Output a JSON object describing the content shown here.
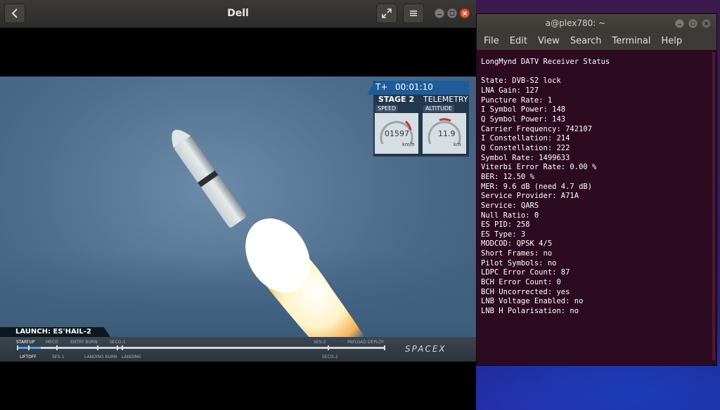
{
  "player": {
    "title": "Dell",
    "video": {
      "clock_prefix": "T+",
      "clock": "00:01:10",
      "stage": "STAGE 2",
      "telemetry": "TELEMETRY",
      "speed_label": "SPEED",
      "speed_value": "01597",
      "speed_unit": "km/h",
      "altitude_label": "ALTITUDE",
      "altitude_value": "11.9",
      "altitude_unit": "km",
      "launch_label": "LAUNCH: ES'HAIL-2",
      "timeline_top": [
        "STARTUP",
        "MECO",
        "ENTRY BURN",
        "SECO-1",
        "SES-2",
        "PAYLOAD DEPLOY"
      ],
      "timeline_bottom": [
        "LIFTOFF",
        "SES-1",
        "LANDING BURN",
        "LANDING",
        "SECO-2"
      ],
      "logo": "SPACEX"
    }
  },
  "terminal": {
    "title": "a@plex780: ~",
    "menu": [
      "File",
      "Edit",
      "View",
      "Search",
      "Terminal",
      "Help"
    ],
    "heading": "LongMynd DATV Receiver Status",
    "lines": [
      "State: DVB-S2 lock",
      "LNA Gain: 127",
      "Puncture Rate: 1",
      "I Symbol Power: 148",
      "Q Symbol Power: 143",
      "Carrier Frequency: 742107",
      "I Constellation: 214",
      "Q Constellation: 222",
      "Symbol Rate: 1499633",
      "Viterbi Error Rate: 0.00 %",
      "BER: 12.50 %",
      "MER: 9.6 dB (need 4.7 dB)",
      "Service Provider: A71A",
      "Service: QARS",
      "Null Ratio: 0",
      "ES PID: 258",
      "ES Type: 3",
      "MODCOD: QPSK 4/5",
      "Short Frames: no",
      "Pilot Symbols: no",
      "LDPC Error Count: 87",
      "BCH Error Count: 0",
      "BCH Uncorrected: yes",
      "LNB Voltage Enabled: no",
      "LNB H Polarisation: no"
    ]
  },
  "colors": {
    "terminal_bg": "#2c0b20",
    "close_button": "#e9542f",
    "telemetry_blue": "#1f5c99"
  }
}
